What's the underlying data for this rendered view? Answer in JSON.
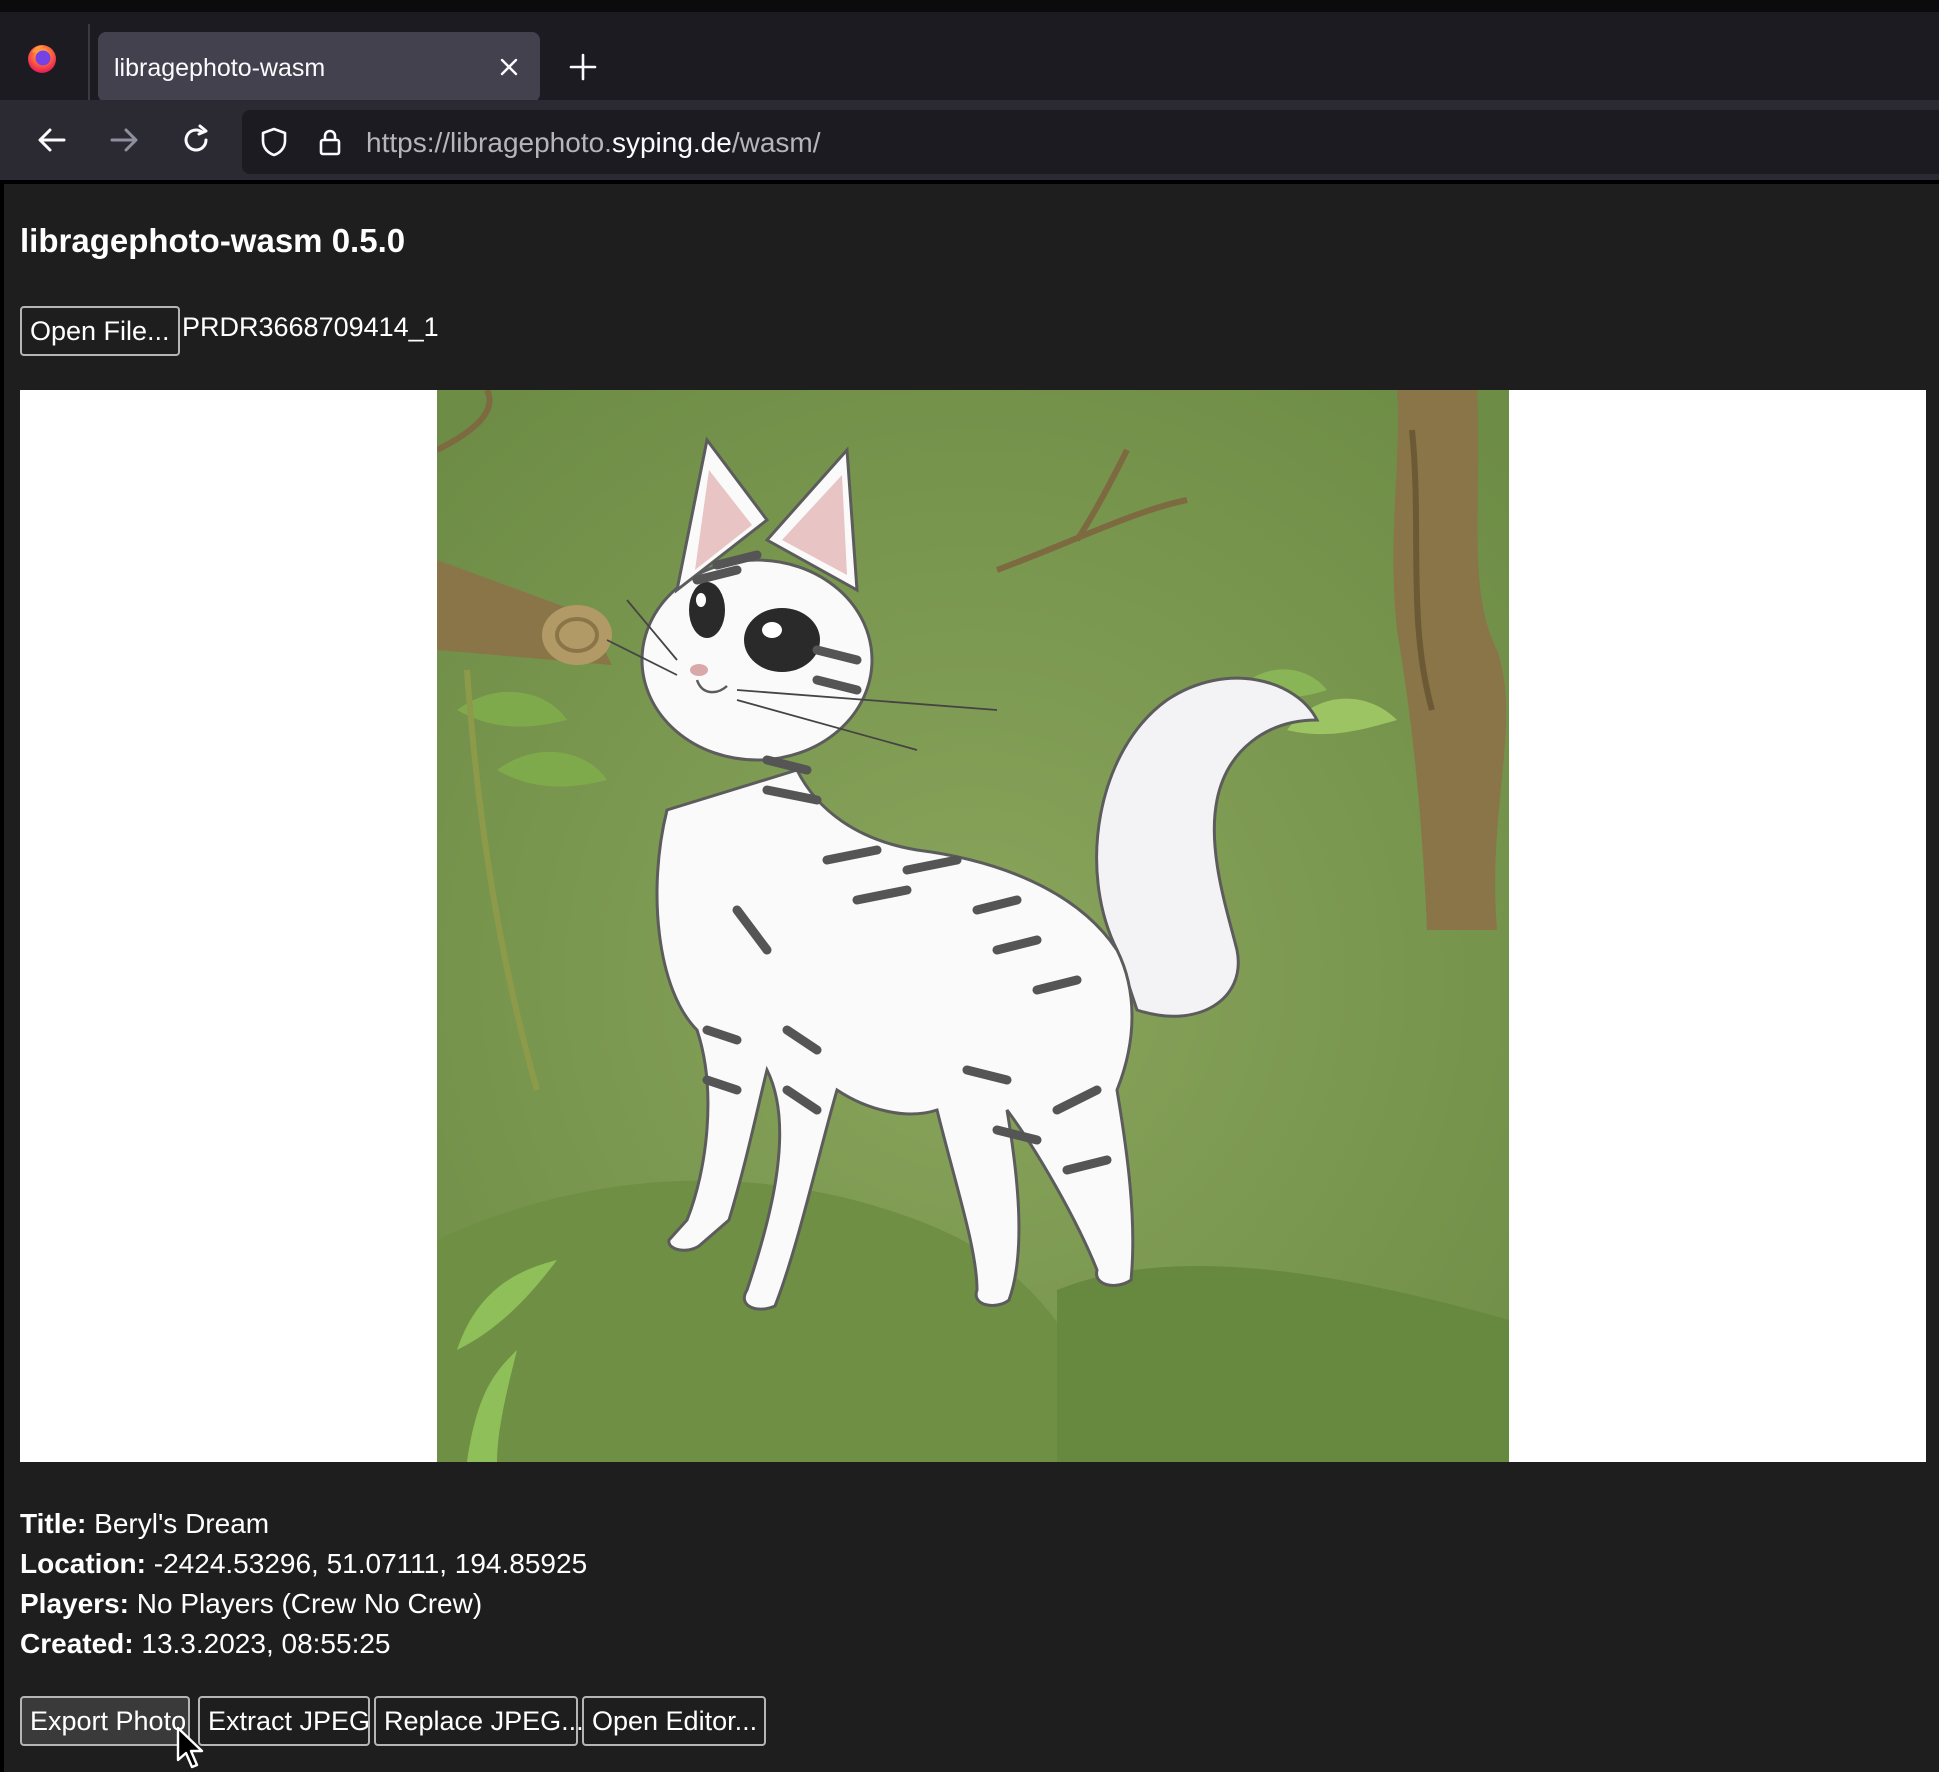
{
  "browser": {
    "tab": {
      "title": "libragephoto-wasm"
    },
    "url": {
      "prefix": "https://libragephoto.",
      "domain": "syping.de",
      "path": "/wasm/"
    },
    "colors": {
      "tab_active": "#42414d",
      "toolbar": "#2b2a33",
      "urlbar": "#1c1b22"
    }
  },
  "page": {
    "title": "libragephoto-wasm 0.5.0",
    "open_file_label": "Open File...",
    "file_name": "PRDR3668709414_1",
    "photo": {
      "icon": "cat-photo"
    },
    "meta": {
      "title_label": "Title:",
      "title_value": "Beryl's Dream",
      "location_label": "Location:",
      "location_value": "-2424.53296, 51.07111, 194.85925",
      "players_label": "Players:",
      "players_value": "No Players (Crew No Crew)",
      "created_label": "Created:",
      "created_value": "13.3.2023, 08:55:25"
    },
    "actions": {
      "export_label": "Export Photo",
      "extract_label": "Extract JPEG",
      "replace_label": "Replace JPEG...",
      "editor_label": "Open Editor..."
    }
  }
}
